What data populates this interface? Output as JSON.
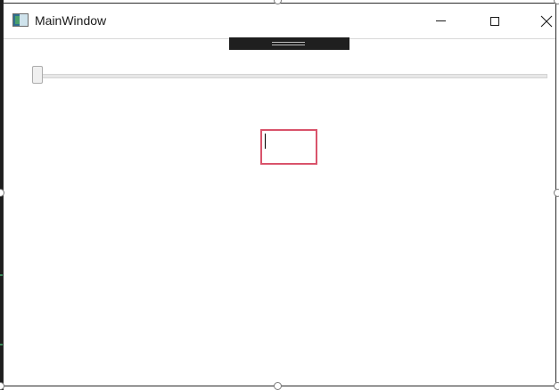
{
  "window": {
    "title": "MainWindow",
    "icon": "app-window-icon"
  },
  "caption_buttons": {
    "minimize_icon": "minimize-icon",
    "maximize_icon": "maximize-icon",
    "close_icon": "close-icon"
  },
  "slider": {
    "value_fraction": 0
  },
  "textbox": {
    "value": "",
    "border_color": "#d9536b"
  },
  "colors": {
    "window_border": "#2b2b2b",
    "adorner": "#1f1f1f"
  }
}
